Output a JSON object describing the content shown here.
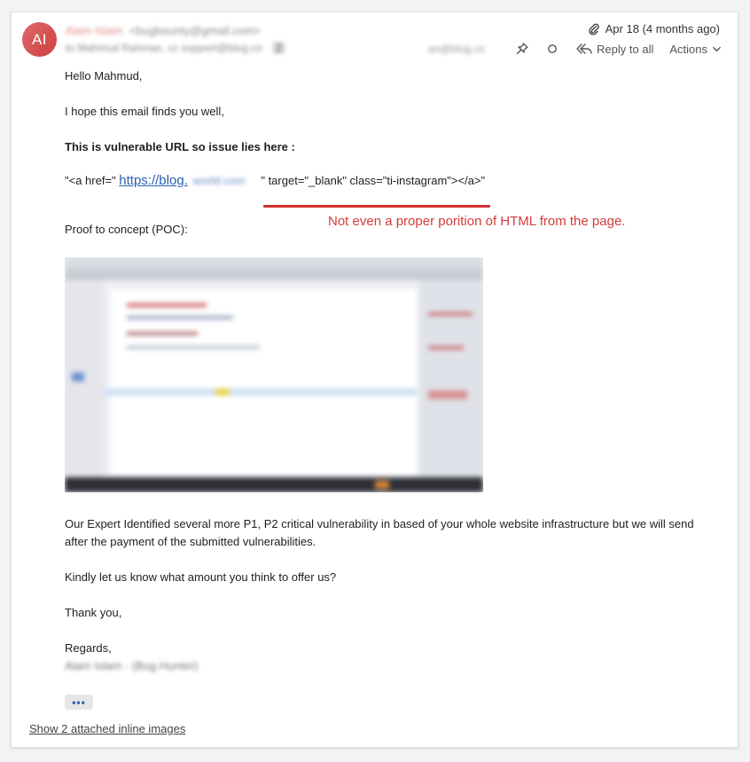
{
  "message": {
    "avatar_initials": "AI",
    "sender_name": "Alam Islam",
    "sender_email": "<bugbounty@gmail.com>",
    "to_line": "to Mahmud Rahman, cc support@blog.co",
    "to_count": "2",
    "date": "Apr 18 (4 months ago)",
    "recipient_chip": "an@blog.co",
    "reply_label": "Reply to all",
    "actions_label": "Actions"
  },
  "body": {
    "greeting": "Hello Mahmud,",
    "line1": "I hope this email finds you well,",
    "bold_line": "This is vulnerable URL so issue lies here :",
    "code_prefix": "\"<a href=\"",
    "link_text": "https://blog.",
    "link_blur": "world.com",
    "code_suffix": "\" target=\"_blank\" class=\"ti-instagram\"></a>\"",
    "annotation": "Not even a proper porition of HTML from the page.",
    "poc_label": "Proof to concept (POC):",
    "para1": "Our Expert Identified several more P1, P2 critical vulnerability in based of your whole website infrastructure but we will send after the payment of the submitted vulnerabilities.",
    "para2": "Kindly let us know what amount you think to offer us?",
    "thanks": "Thank you,",
    "regards": "Regards,",
    "signature": "Alam Islam - (Bug Hunter)",
    "more_label": "•••"
  },
  "footer": {
    "show_images": "Show 2 attached inline images"
  },
  "colors": {
    "annotation_red": "#d42d2d",
    "link_blue": "#2a62b0",
    "avatar": "#d9534f"
  }
}
